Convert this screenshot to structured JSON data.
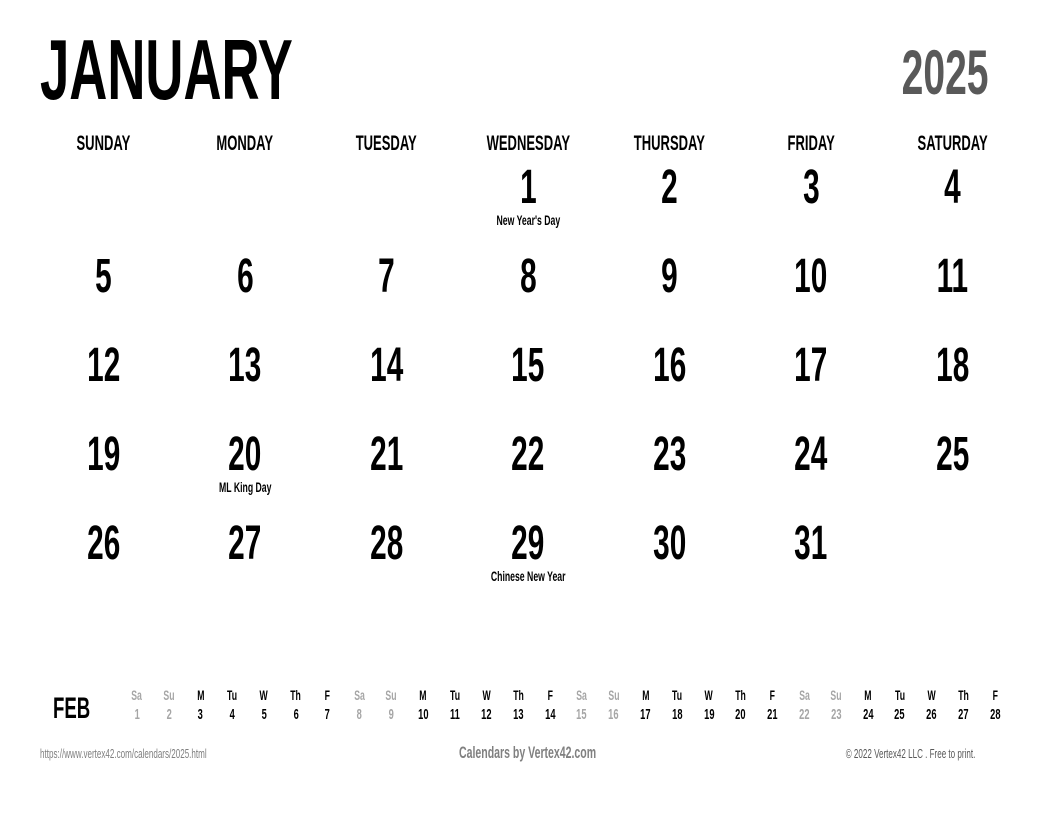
{
  "header": {
    "month": "JANUARY",
    "year": "2025",
    "month_color": "#000000",
    "year_color": "#595959"
  },
  "weekdays": [
    "SUNDAY",
    "MONDAY",
    "TUESDAY",
    "WEDNESDAY",
    "THURSDAY",
    "FRIDAY",
    "SATURDAY"
  ],
  "weeks": [
    [
      {
        "day": "",
        "note": ""
      },
      {
        "day": "",
        "note": ""
      },
      {
        "day": "",
        "note": ""
      },
      {
        "day": "1",
        "note": "New Year's Day"
      },
      {
        "day": "2",
        "note": ""
      },
      {
        "day": "3",
        "note": ""
      },
      {
        "day": "4",
        "note": ""
      }
    ],
    [
      {
        "day": "5",
        "note": ""
      },
      {
        "day": "6",
        "note": ""
      },
      {
        "day": "7",
        "note": ""
      },
      {
        "day": "8",
        "note": ""
      },
      {
        "day": "9",
        "note": ""
      },
      {
        "day": "10",
        "note": ""
      },
      {
        "day": "11",
        "note": ""
      }
    ],
    [
      {
        "day": "12",
        "note": ""
      },
      {
        "day": "13",
        "note": ""
      },
      {
        "day": "14",
        "note": ""
      },
      {
        "day": "15",
        "note": ""
      },
      {
        "day": "16",
        "note": ""
      },
      {
        "day": "17",
        "note": ""
      },
      {
        "day": "18",
        "note": ""
      }
    ],
    [
      {
        "day": "19",
        "note": ""
      },
      {
        "day": "20",
        "note": "ML King Day"
      },
      {
        "day": "21",
        "note": ""
      },
      {
        "day": "22",
        "note": ""
      },
      {
        "day": "23",
        "note": ""
      },
      {
        "day": "24",
        "note": ""
      },
      {
        "day": "25",
        "note": ""
      }
    ],
    [
      {
        "day": "26",
        "note": ""
      },
      {
        "day": "27",
        "note": ""
      },
      {
        "day": "28",
        "note": ""
      },
      {
        "day": "29",
        "note": "Chinese New Year"
      },
      {
        "day": "30",
        "note": ""
      },
      {
        "day": "31",
        "note": ""
      },
      {
        "day": "",
        "note": ""
      }
    ]
  ],
  "mini_month": {
    "label": "FEB",
    "weekend_color": "#a6a6a6",
    "weekday_color": "#000000",
    "days": [
      {
        "dow": "Sa",
        "num": "1",
        "weekend": true
      },
      {
        "dow": "Su",
        "num": "2",
        "weekend": true
      },
      {
        "dow": "M",
        "num": "3",
        "weekend": false
      },
      {
        "dow": "Tu",
        "num": "4",
        "weekend": false
      },
      {
        "dow": "W",
        "num": "5",
        "weekend": false
      },
      {
        "dow": "Th",
        "num": "6",
        "weekend": false
      },
      {
        "dow": "F",
        "num": "7",
        "weekend": false
      },
      {
        "dow": "Sa",
        "num": "8",
        "weekend": true
      },
      {
        "dow": "Su",
        "num": "9",
        "weekend": true
      },
      {
        "dow": "M",
        "num": "10",
        "weekend": false
      },
      {
        "dow": "Tu",
        "num": "11",
        "weekend": false
      },
      {
        "dow": "W",
        "num": "12",
        "weekend": false
      },
      {
        "dow": "Th",
        "num": "13",
        "weekend": false
      },
      {
        "dow": "F",
        "num": "14",
        "weekend": false
      },
      {
        "dow": "Sa",
        "num": "15",
        "weekend": true
      },
      {
        "dow": "Su",
        "num": "16",
        "weekend": true
      },
      {
        "dow": "M",
        "num": "17",
        "weekend": false
      },
      {
        "dow": "Tu",
        "num": "18",
        "weekend": false
      },
      {
        "dow": "W",
        "num": "19",
        "weekend": false
      },
      {
        "dow": "Th",
        "num": "20",
        "weekend": false
      },
      {
        "dow": "F",
        "num": "21",
        "weekend": false
      },
      {
        "dow": "Sa",
        "num": "22",
        "weekend": true
      },
      {
        "dow": "Su",
        "num": "23",
        "weekend": true
      },
      {
        "dow": "M",
        "num": "24",
        "weekend": false
      },
      {
        "dow": "Tu",
        "num": "25",
        "weekend": false
      },
      {
        "dow": "W",
        "num": "26",
        "weekend": false
      },
      {
        "dow": "Th",
        "num": "27",
        "weekend": false
      },
      {
        "dow": "F",
        "num": "28",
        "weekend": false
      }
    ]
  },
  "footer": {
    "url": "https://www.vertex42.com/calendars/2025.html",
    "credit": "Calendars by Vertex42.com",
    "copyright": "© 2022 Vertex42 LLC . Free to print."
  }
}
